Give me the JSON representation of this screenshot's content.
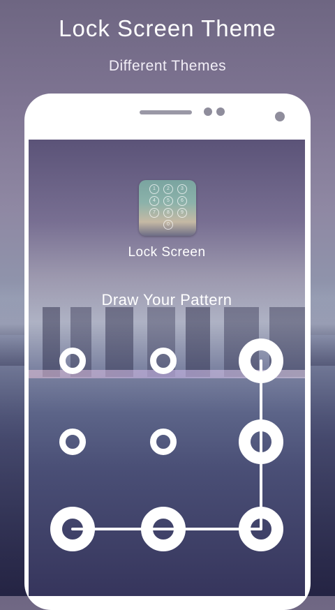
{
  "header": {
    "title": "Lock Screen Theme",
    "subtitle": "Different Themes"
  },
  "lockscreen": {
    "app_name": "Lock Screen",
    "prompt": "Draw Your Pattern",
    "app_icon_digits": [
      "1",
      "2",
      "3",
      "4",
      "5",
      "6",
      "7",
      "8",
      "9",
      "0"
    ],
    "pattern": {
      "grid": "3x3",
      "selected_nodes": [
        3,
        6,
        9,
        8,
        7
      ],
      "line_color": "#ffffff"
    }
  }
}
